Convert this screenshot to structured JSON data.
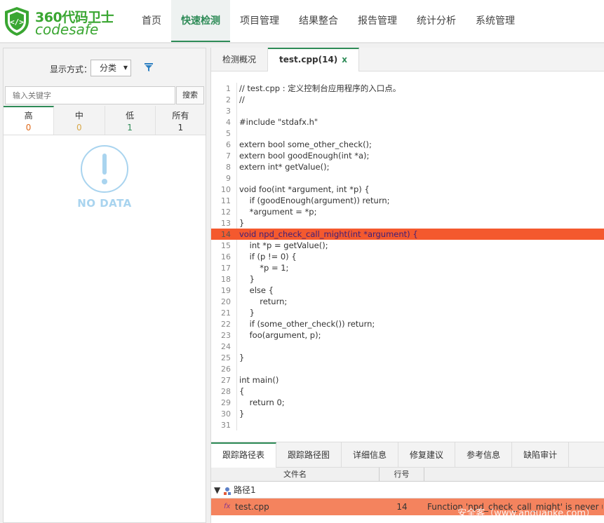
{
  "brand": {
    "cn": "360代码卫士",
    "en": "codesafe",
    "color": "#3aa632"
  },
  "nav": [
    {
      "label": "首页",
      "active": false
    },
    {
      "label": "快速检测",
      "active": true
    },
    {
      "label": "项目管理",
      "active": false
    },
    {
      "label": "结果整合",
      "active": false
    },
    {
      "label": "报告管理",
      "active": false
    },
    {
      "label": "统计分析",
      "active": false
    },
    {
      "label": "系统管理",
      "active": false
    }
  ],
  "left": {
    "display_label": "显示方式：",
    "display_value": "分类",
    "search_placeholder": "输入关键字",
    "search_button": "搜索",
    "severity": [
      {
        "name": "高",
        "count": "0",
        "color": "#e06a1b"
      },
      {
        "name": "中",
        "count": "0",
        "color": "#d8a84a"
      },
      {
        "name": "低",
        "count": "1",
        "color": "#2e8b57"
      },
      {
        "name": "所有",
        "count": "1",
        "color": "#333333"
      }
    ],
    "no_data": "NO DATA"
  },
  "tabs": [
    {
      "label": "检测概况",
      "active": false
    },
    {
      "label": "test.cpp(14)",
      "active": true,
      "close": "x"
    }
  ],
  "code": {
    "highlight_line": 14,
    "lines": [
      "// test.cpp : 定义控制台应用程序的入口点。",
      "//",
      "",
      "#include \"stdafx.h\"",
      "",
      "extern bool some_other_check();",
      "extern bool goodEnough(int *a);",
      "extern int* getValue();",
      "",
      "void foo(int *argument, int *p) {",
      "    if (goodEnough(argument)) return;",
      "    *argument = *p;",
      "}",
      "void npd_check_call_might(int *argument) {",
      "    int *p = getValue();",
      "    if (p != 0) {",
      "        *p = 1;",
      "    }",
      "    else {",
      "        return;",
      "    }",
      "    if (some_other_check()) return;",
      "    foo(argument, p);",
      "",
      "}",
      "",
      "int main()",
      "{",
      "    return 0;",
      "}",
      ""
    ]
  },
  "bottom_tabs": [
    {
      "label": "跟踪路径表",
      "active": true
    },
    {
      "label": "跟踪路径图",
      "active": false
    },
    {
      "label": "详细信息",
      "active": false
    },
    {
      "label": "修复建议",
      "active": false
    },
    {
      "label": "参考信息",
      "active": false
    },
    {
      "label": "缺陷审计",
      "active": false
    }
  ],
  "trace": {
    "columns": [
      "文件名",
      "行号",
      ""
    ],
    "group": {
      "toggle": "▼",
      "label": "路径1"
    },
    "rows": [
      {
        "icon": "fx",
        "file": "test.cpp",
        "line": "14",
        "message": "Function 'npd_check_call_might' is never used"
      }
    ]
  },
  "watermark": "安全客（www.anquanke.com）",
  "colors": {
    "accent": "#2e8b57",
    "highlight": "#f4592e",
    "row_highlight": "#f4835e"
  }
}
